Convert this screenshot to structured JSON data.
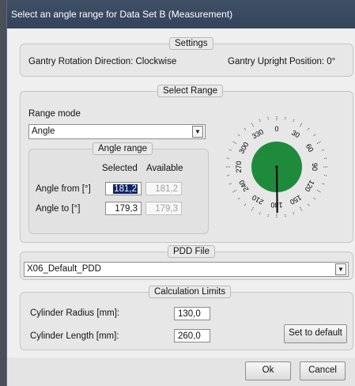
{
  "window": {
    "title": "Select an angle range for Data Set B (Measurement)"
  },
  "settings": {
    "legend": "Settings",
    "rotation_direction": "Gantry Rotation Direction: Clockwise",
    "upright_position": "Gantry Upright Position: 0°"
  },
  "select_range": {
    "legend": "Select Range",
    "range_mode_label": "Range mode",
    "range_mode_value": "Angle",
    "angle_range": {
      "legend": "Angle range",
      "col_selected": "Selected",
      "col_available": "Available",
      "from_label": "Angle from [°]",
      "from_selected": "181,2",
      "from_available": "181,2",
      "to_label": "Angle to [°]",
      "to_selected": "179,3",
      "to_available": "179,3"
    },
    "dial": {
      "labels": [
        "0",
        "30",
        "60",
        "90",
        "120",
        "150",
        "180",
        "210",
        "240",
        "270",
        "300",
        "330"
      ],
      "fill_color": "#1e8a3c",
      "selected_from_deg": 181.2,
      "selected_to_deg": 179.3
    }
  },
  "pdd_file": {
    "legend": "PDD File",
    "value": "X06_Default_PDD"
  },
  "calc_limits": {
    "legend": "Calculation Limits",
    "radius_label": "Cylinder Radius [mm]:",
    "radius_value": "130,0",
    "length_label": "Cylinder Length [mm]:",
    "length_value": "260,0",
    "default_button": "Set to default"
  },
  "footer": {
    "ok": "Ok",
    "cancel": "Cancel"
  }
}
